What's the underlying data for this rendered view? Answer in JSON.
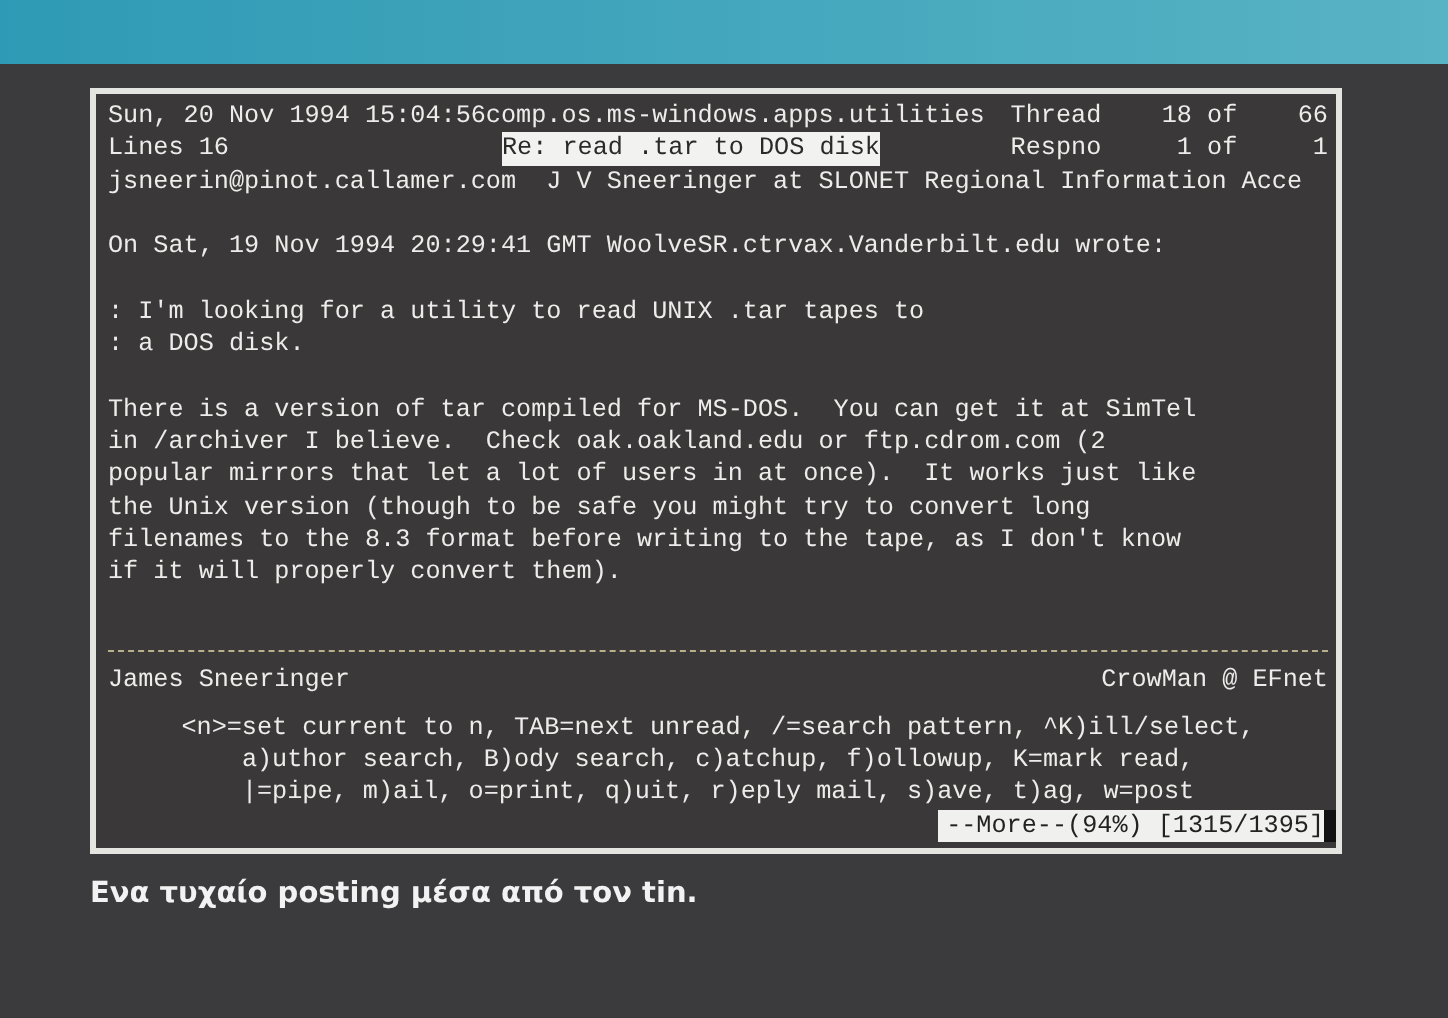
{
  "terminal": {
    "header": [
      {
        "left": "Sun, 20 Nov 1994 15:04:56comp.os.ms-windows.apps.utilities",
        "right": "Thread    18 of    66"
      },
      {
        "left": "Lines 16",
        "subject": "Re: read .tar to DOS disk",
        "right": "Respno     1 of     1"
      },
      {
        "left": "jsneerin@pinot.callamer.com  J V Sneeringer at SLONET Regional Information Acce"
      }
    ],
    "attribution": "On Sat, 19 Nov 1994 20:29:41 GMT WoolveSR.ctrvax.Vanderbilt.edu wrote:",
    "quote": [
      ": I'm looking for a utility to read UNIX .tar tapes to",
      ": a DOS disk."
    ],
    "body": [
      "There is a version of tar compiled for MS-DOS.  You can get it at SimTel",
      "in /archiver I believe.  Check oak.oakland.edu or ftp.cdrom.com (2",
      "popular mirrors that let a lot of users in at once).  It works just like",
      "the Unix version (though to be safe you might try to convert long",
      "filenames to the 8.3 format before writing to the tape, as I don't know",
      "if it will properly convert them)."
    ],
    "signature": {
      "name": "James Sneeringer",
      "nick": "CrowMan @ EFnet"
    },
    "help": [
      "<n>=set current to n, TAB=next unread, /=search pattern, ^K)ill/select,",
      "a)uthor search, B)ody search, c)atchup, f)ollowup, K=mark read,",
      "|=pipe, m)ail, o=print, q)uit, r)eply mail, s)ave, t)ag, w=post"
    ],
    "status": "--More--(94%) [1315/1395]"
  },
  "caption": "Ενα τυχαίο posting μέσα από τον tin."
}
